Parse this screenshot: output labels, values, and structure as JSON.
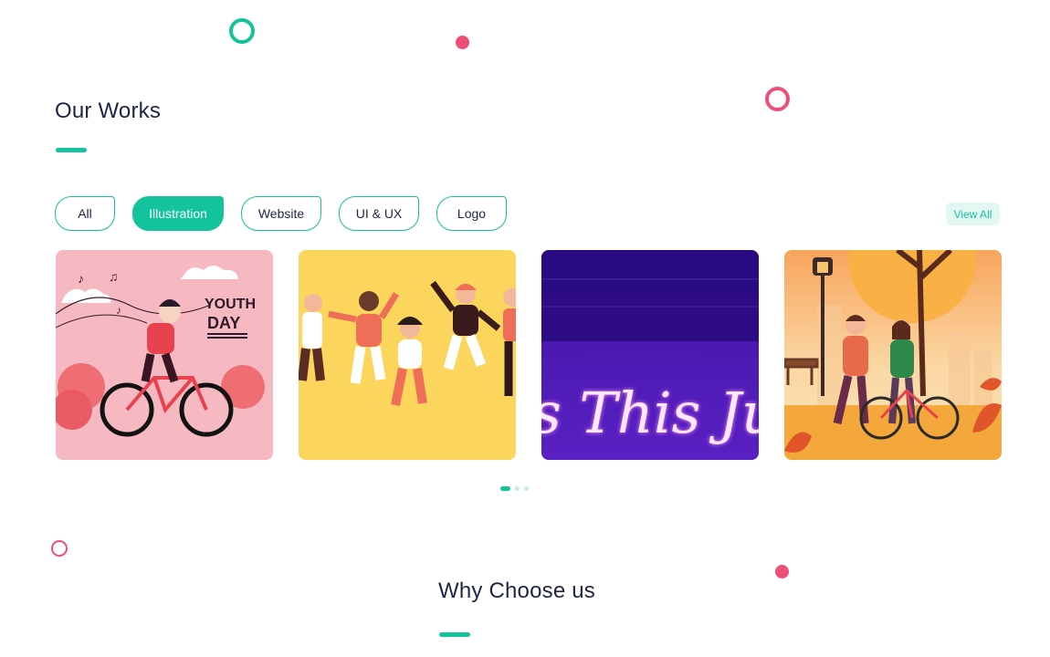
{
  "works": {
    "title": "Our Works",
    "filters": [
      {
        "label": "All",
        "active": false
      },
      {
        "label": "Illustration",
        "active": true
      },
      {
        "label": "Website",
        "active": false
      },
      {
        "label": "UI & UX",
        "active": false
      },
      {
        "label": "Logo",
        "active": false
      }
    ],
    "view_all_label": "View All",
    "cards": [
      {
        "subject": "Youth Day cyclist illustration",
        "text_line1": "YOUTH",
        "text_line2": "DAY"
      },
      {
        "subject": "Jumping friends illustration"
      },
      {
        "subject": "Neon sign photo",
        "neon_text": "s This Just"
      },
      {
        "subject": "Autumn park couple with bicycle illustration"
      }
    ],
    "pagination": {
      "total": 3,
      "active_index": 0
    }
  },
  "why": {
    "title": "Why Choose us"
  },
  "colors": {
    "accent": "#13c39b",
    "pink": "#ef4f77",
    "heading": "#1f2547"
  }
}
